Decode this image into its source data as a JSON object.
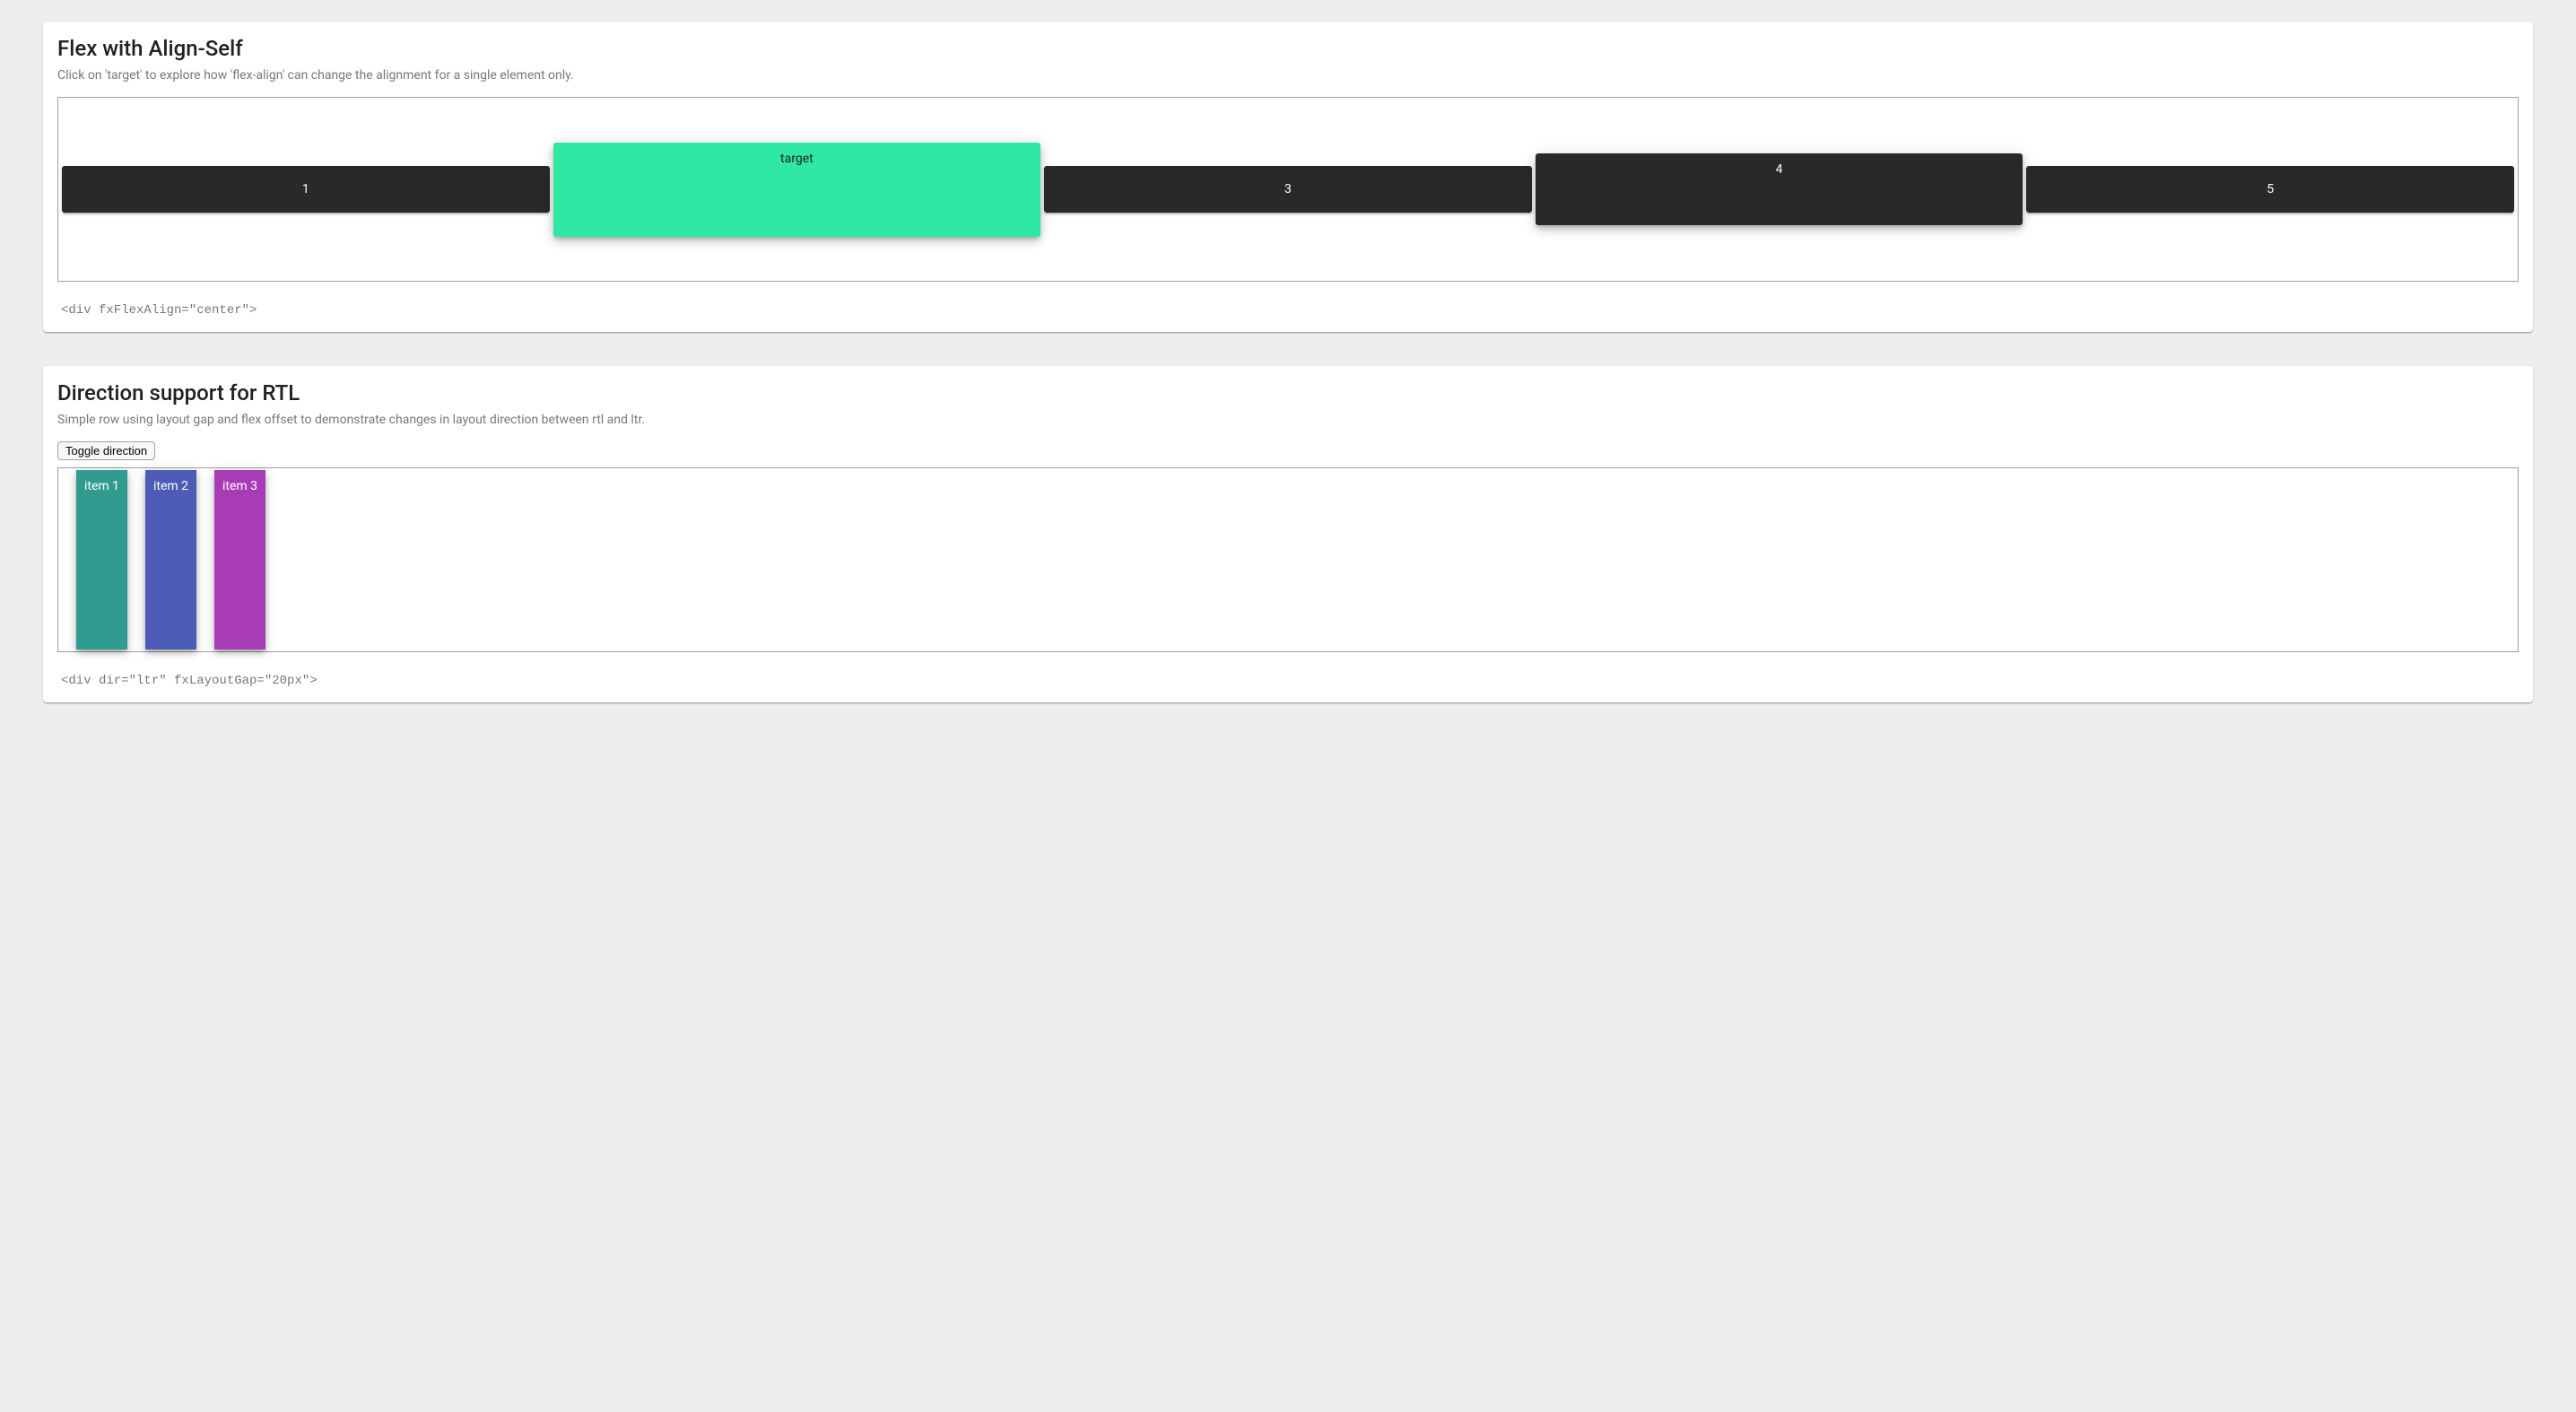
{
  "align_self": {
    "title": "Flex with Align-Self",
    "subtitle": "Click on 'target' to explore how 'flex-align' can change the alignment for a single element only.",
    "items": {
      "i1": "1",
      "target": "target",
      "i3": "3",
      "i4": "4",
      "i5": "5"
    },
    "hint": "<div fxFlexAlign=\"center\">"
  },
  "rtl": {
    "title": "Direction support for RTL",
    "subtitle": "Simple row using layout gap and flex offset to demonstrate changes in layout direction between rtl and ltr.",
    "toggle_label": "Toggle direction",
    "items": {
      "i1": {
        "label": "item 1",
        "color": "#309b8f"
      },
      "i2": {
        "label": "item 2",
        "color": "#4d5cb6"
      },
      "i3": {
        "label": "item 3",
        "color": "#a83cb6"
      }
    },
    "hint": "<div dir=\"ltr\" fxLayoutGap=\"20px\">"
  }
}
